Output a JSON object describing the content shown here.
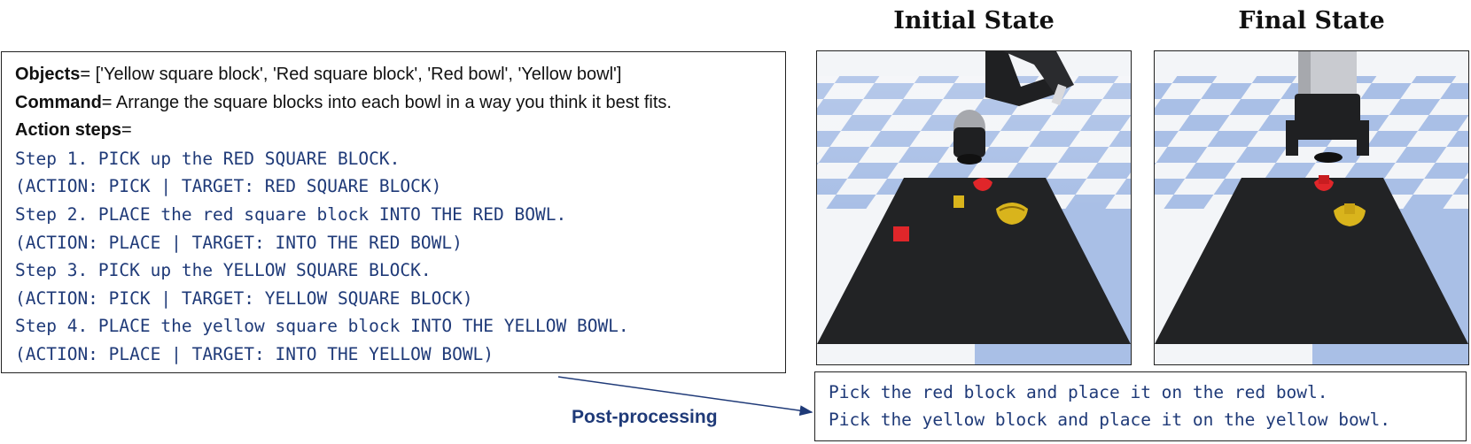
{
  "prompt": {
    "objects_label": "Objects",
    "objects_value": "= ['Yellow square block', 'Red square block', 'Red bowl', 'Yellow bowl']",
    "command_label": "Command",
    "command_value": "= Arrange the square blocks into each bowl in a way you think it best fits.",
    "steps_label": "Action steps",
    "steps_suffix": "=",
    "steps": [
      "Step 1. PICK up the RED SQUARE BLOCK.",
      "(ACTION: PICK | TARGET: RED SQUARE BLOCK)",
      "Step 2. PLACE the red square block INTO THE RED BOWL.",
      "(ACTION: PLACE | TARGET: INTO THE RED BOWL)",
      "Step 3. PICK up the YELLOW SQUARE BLOCK.",
      "(ACTION: PICK | TARGET: YELLOW SQUARE BLOCK)",
      "Step 4. PLACE the yellow square block INTO THE YELLOW BOWL.",
      "(ACTION: PLACE | TARGET: INTO THE YELLOW BOWL)"
    ]
  },
  "initial_state_title": "Initial State",
  "final_state_title": "Final State",
  "post_processing_label": "Post-processing",
  "output_lines": [
    "Pick the red block and place it on the red bowl.",
    "Pick the yellow block and place it on the yellow bowl."
  ],
  "colors": {
    "text_blue": "#1f3a78",
    "table": "#222325",
    "checker_blue": "#a9bfe6",
    "checker_white": "#f3f5f8",
    "red_object": "#e0262a",
    "yellow_object": "#d9b41c"
  }
}
